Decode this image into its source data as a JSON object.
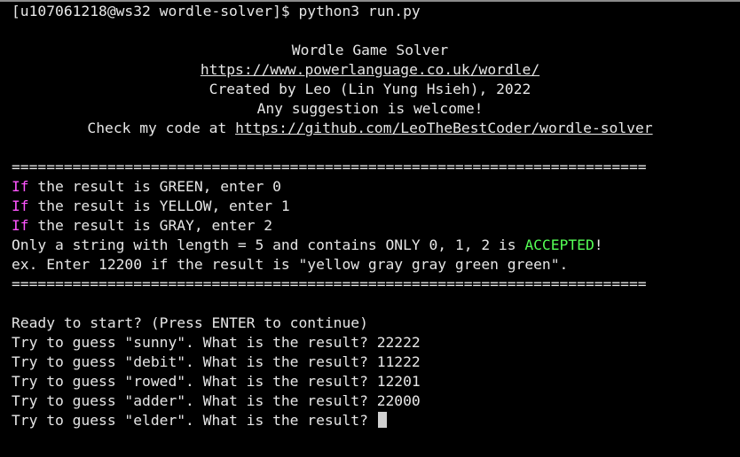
{
  "prompt": "[u107061218@ws32 wordle-solver]$ python3 run.py",
  "banner": {
    "title": "Wordle Game Solver",
    "url": "https://www.powerlanguage.co.uk/wordle/",
    "credit": "Created by Leo (Lin Yung Hsieh), 2022",
    "suggestion": "Any suggestion is welcome!",
    "code_prefix": "Check my code at ",
    "code_url": "https://github.com/LeoTheBestCoder/wordle-solver"
  },
  "separator": "=========================================================================",
  "rules": [
    {
      "keyword": "If",
      "rest": " the result is GREEN, enter 0"
    },
    {
      "keyword": "If",
      "rest": " the result is YELLOW, enter 1"
    },
    {
      "keyword": "If",
      "rest": " the result is GRAY, enter 2"
    }
  ],
  "accepted_line": {
    "before": "Only a string with length = 5 and contains ONLY 0, 1, 2 is ",
    "highlight": "ACCEPTED",
    "after": "!"
  },
  "example": "ex. Enter 12200 if the result is \"yellow gray gray green green\".",
  "session": [
    "Ready to start? (Press ENTER to continue)",
    "Try to guess \"sunny\". What is the result? 22222",
    "Try to guess \"debit\". What is the result? 11222",
    "Try to guess \"rowed\". What is the result? 12201",
    "Try to guess \"adder\". What is the result? 22000",
    "Try to guess \"elder\". What is the result? "
  ],
  "colors": {
    "background": "#000000",
    "text": "#e6e6e6",
    "keyword": "#ff55ff",
    "accepted": "#55ff55"
  }
}
